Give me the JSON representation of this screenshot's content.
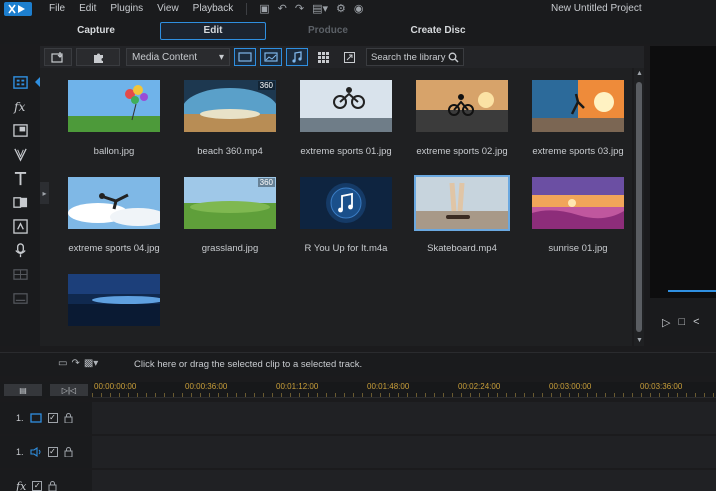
{
  "app": {
    "menu": [
      "File",
      "Edit",
      "Plugins",
      "View",
      "Playback"
    ],
    "project_title": "New Untitled Project"
  },
  "modes": {
    "capture": "Capture",
    "edit": "Edit",
    "produce": "Produce",
    "create_disc": "Create Disc"
  },
  "library_toolbar": {
    "content_dropdown": "Media Content",
    "search_placeholder": "Search the library"
  },
  "library": {
    "items": [
      {
        "name": "ballon.jpg",
        "thumb": "balloons",
        "badge": ""
      },
      {
        "name": "beach 360.mp4",
        "thumb": "beach",
        "badge": "360"
      },
      {
        "name": "extreme sports 01.jpg",
        "thumb": "bike",
        "badge": ""
      },
      {
        "name": "extreme sports 02.jpg",
        "thumb": "bike-sunset",
        "badge": ""
      },
      {
        "name": "extreme sports 03.jpg",
        "thumb": "skater-sun",
        "badge": ""
      },
      {
        "name": "extreme sports 04.jpg",
        "thumb": "skydiver",
        "badge": ""
      },
      {
        "name": "grassland.jpg",
        "thumb": "grass",
        "badge": "360"
      },
      {
        "name": "R You Up for It.m4a",
        "thumb": "audio",
        "badge": ""
      },
      {
        "name": "Skateboard.mp4",
        "thumb": "skateboard",
        "badge": ""
      },
      {
        "name": "sunrise 01.jpg",
        "thumb": "sunrise",
        "badge": ""
      },
      {
        "name": "",
        "thumb": "night-lake",
        "badge": ""
      }
    ]
  },
  "timeline": {
    "hint": "Click here or drag the selected clip to a selected track.",
    "ruler": [
      "00:00:00:00",
      "00:00:36:00",
      "00:01:12:00",
      "00:01:48:00",
      "00:02:24:00",
      "00:03:00:00",
      "00:03:36:00"
    ],
    "tracks": [
      {
        "label": "1.",
        "type": "video"
      },
      {
        "label": "1.",
        "type": "audio"
      },
      {
        "label": "fx",
        "type": "effect"
      }
    ]
  },
  "colors": {
    "accent": "#2f8fe0",
    "ruler_text": "#c99f3a",
    "background": "#1b1b1d"
  }
}
